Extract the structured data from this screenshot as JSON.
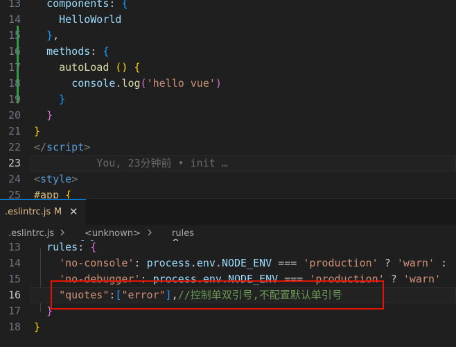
{
  "top_editor": {
    "lines": [
      {
        "num": "13",
        "tokens": [
          {
            "t": "  "
          },
          {
            "t": "components",
            "c": "kw"
          },
          {
            "t": ": "
          },
          {
            "t": "{",
            "c": "b3"
          }
        ]
      },
      {
        "num": "14",
        "tokens": [
          {
            "t": "    HelloWorld",
            "c": "kw"
          }
        ]
      },
      {
        "num": "15",
        "tokens": [
          {
            "t": "  "
          },
          {
            "t": "}",
            "c": "b3"
          },
          {
            "t": ","
          }
        ]
      },
      {
        "num": "16",
        "tokens": [
          {
            "t": "  "
          },
          {
            "t": "methods",
            "c": "kw"
          },
          {
            "t": ": "
          },
          {
            "t": "{",
            "c": "b3"
          }
        ]
      },
      {
        "num": "17",
        "tokens": [
          {
            "t": "    "
          },
          {
            "t": "autoLoad",
            "c": "fn"
          },
          {
            "t": " "
          },
          {
            "t": "()",
            "c": "b1"
          },
          {
            "t": " "
          },
          {
            "t": "{",
            "c": "b1"
          }
        ]
      },
      {
        "num": "18",
        "tokens": [
          {
            "t": "      "
          },
          {
            "t": "console",
            "c": "kw"
          },
          {
            "t": "."
          },
          {
            "t": "log",
            "c": "fn"
          },
          {
            "t": "(",
            "c": "b2"
          },
          {
            "t": "'hello vue'",
            "c": "str"
          },
          {
            "t": ")",
            "c": "b2"
          }
        ]
      },
      {
        "num": "19",
        "tokens": [
          {
            "t": "    "
          },
          {
            "t": "}",
            "c": "b3"
          }
        ]
      },
      {
        "num": "20",
        "tokens": [
          {
            "t": "  "
          },
          {
            "t": "}",
            "c": "b2"
          }
        ]
      },
      {
        "num": "21",
        "tokens": [
          {
            "t": "}",
            "c": "b1"
          }
        ]
      },
      {
        "num": "22",
        "tokens": [
          {
            "t": "</",
            "c": "tag"
          },
          {
            "t": "script",
            "c": "tagname"
          },
          {
            "t": ">",
            "c": "tag"
          }
        ]
      },
      {
        "num": "23",
        "active": true,
        "tokens": [
          {
            "t": "          You, 23分钟前 • init …",
            "c": "blame"
          }
        ]
      },
      {
        "num": "24",
        "tokens": [
          {
            "t": "<",
            "c": "tag"
          },
          {
            "t": "style",
            "c": "tagname"
          },
          {
            "t": ">",
            "c": "tag"
          }
        ]
      },
      {
        "num": "25",
        "tokens": [
          {
            "t": "#app",
            "c": "sel"
          },
          {
            "t": " "
          },
          {
            "t": "{",
            "c": "b1"
          }
        ]
      }
    ]
  },
  "tab": {
    "filename": ".eslintrc.js",
    "badge": "M",
    "close": "✕"
  },
  "breadcrumb": {
    "file": ".eslintrc.js",
    "symbol": "<unknown>",
    "item": "rules"
  },
  "bottom_editor": {
    "lines": [
      {
        "num": "13",
        "tokens": [
          {
            "t": "  "
          },
          {
            "t": "rules",
            "c": "kw"
          },
          {
            "t": ": "
          },
          {
            "t": "{",
            "c": "b2"
          }
        ]
      },
      {
        "num": "14",
        "tokens": [
          {
            "t": "    "
          },
          {
            "t": "'no-console'",
            "c": "str"
          },
          {
            "t": ": "
          },
          {
            "t": "process",
            "c": "kw"
          },
          {
            "t": "."
          },
          {
            "t": "env",
            "c": "kw"
          },
          {
            "t": "."
          },
          {
            "t": "NODE_ENV",
            "c": "kw"
          },
          {
            "t": " === "
          },
          {
            "t": "'production'",
            "c": "str"
          },
          {
            "t": " ? "
          },
          {
            "t": "'warn'",
            "c": "str"
          },
          {
            "t": " :"
          }
        ]
      },
      {
        "num": "15",
        "tokens": [
          {
            "t": "    "
          },
          {
            "t": "'no-debugger'",
            "c": "str"
          },
          {
            "t": ": "
          },
          {
            "t": "process",
            "c": "kw"
          },
          {
            "t": "."
          },
          {
            "t": "env",
            "c": "kw"
          },
          {
            "t": "."
          },
          {
            "t": "NODE_ENV",
            "c": "kw"
          },
          {
            "t": " === "
          },
          {
            "t": "'production'",
            "c": "str"
          },
          {
            "t": " ? "
          },
          {
            "t": "'warn'",
            "c": "str"
          }
        ]
      },
      {
        "num": "16",
        "active": true,
        "tokens": [
          {
            "t": "    "
          },
          {
            "t": "\"quotes\"",
            "c": "str"
          },
          {
            "t": ":"
          },
          {
            "t": "[",
            "c": "b3"
          },
          {
            "t": "\"error\"",
            "c": "str"
          },
          {
            "t": "]",
            "c": "b3"
          },
          {
            "t": ","
          },
          {
            "t": "//控制单双引号,不配置默认单引号",
            "c": "cmt"
          }
        ]
      },
      {
        "num": "17",
        "tokens": [
          {
            "t": "  "
          },
          {
            "t": "}",
            "c": "b2"
          }
        ]
      },
      {
        "num": "18",
        "tokens": [
          {
            "t": "}",
            "c": "b1"
          }
        ]
      }
    ]
  },
  "colors": {
    "annotation_box": "#e51400",
    "modified_file": "#e2c08d",
    "git_added_bar": "#2ea043"
  }
}
